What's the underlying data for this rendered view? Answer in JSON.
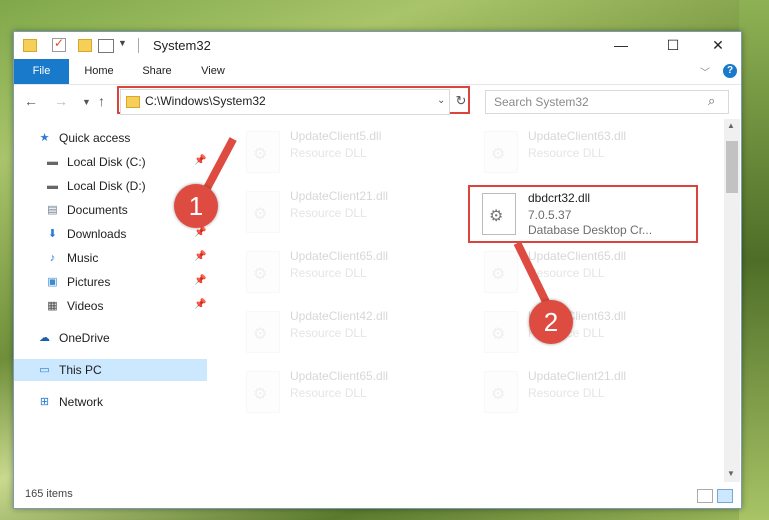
{
  "window": {
    "title": "System32"
  },
  "ribbon": {
    "tabs": [
      "File",
      "Home",
      "Share",
      "View"
    ]
  },
  "address": {
    "path": "C:\\Windows\\System32"
  },
  "search": {
    "placeholder": "Search System32"
  },
  "sidebar": {
    "items": [
      {
        "label": "Quick access",
        "icon": "star-icon",
        "pinned": false
      },
      {
        "label": "Local Disk (C:)",
        "icon": "drive-icon",
        "pinned": true
      },
      {
        "label": "Local Disk (D:)",
        "icon": "drive-icon",
        "pinned": false
      },
      {
        "label": "Documents",
        "icon": "documents-icon",
        "pinned": true
      },
      {
        "label": "Downloads",
        "icon": "download-icon",
        "pinned": true
      },
      {
        "label": "Music",
        "icon": "music-icon",
        "pinned": true
      },
      {
        "label": "Pictures",
        "icon": "pictures-icon",
        "pinned": true
      },
      {
        "label": "Videos",
        "icon": "videos-icon",
        "pinned": true
      },
      {
        "label": "OneDrive",
        "icon": "cloud-icon",
        "pinned": false
      },
      {
        "label": "This PC",
        "icon": "pc-icon",
        "pinned": false,
        "selected": true
      },
      {
        "label": "Network",
        "icon": "network-icon",
        "pinned": false
      }
    ]
  },
  "files": [
    {
      "name": "UpdateClient5.dll",
      "type": "Resource DLL"
    },
    {
      "name": "UpdateClient63.dll",
      "type": "Resource DLL"
    },
    {
      "name": "UpdateClient21.dll",
      "type": "Resource DLL"
    },
    {
      "name": "dbdcrt32.dll",
      "version": "7.0.5.37",
      "type": "Database Desktop Cr...",
      "highlighted": true
    },
    {
      "name": "UpdateClient65.dll",
      "type": "Resource DLL"
    },
    {
      "name": "UpdateClient65.dll",
      "type": "Resource DLL"
    },
    {
      "name": "UpdateClient42.dll",
      "type": "Resource DLL"
    },
    {
      "name": "UpdateClient63.dll",
      "type": "Resource DLL"
    },
    {
      "name": "UpdateClient65.dll",
      "type": "Resource DLL"
    },
    {
      "name": "UpdateClient21.dll",
      "type": "Resource DLL"
    }
  ],
  "status": {
    "items_count": "165 items"
  },
  "callouts": [
    "1",
    "2"
  ],
  "colors": {
    "accent": "#1979ca",
    "callout": "#de4b40",
    "selection": "#cce8ff"
  }
}
